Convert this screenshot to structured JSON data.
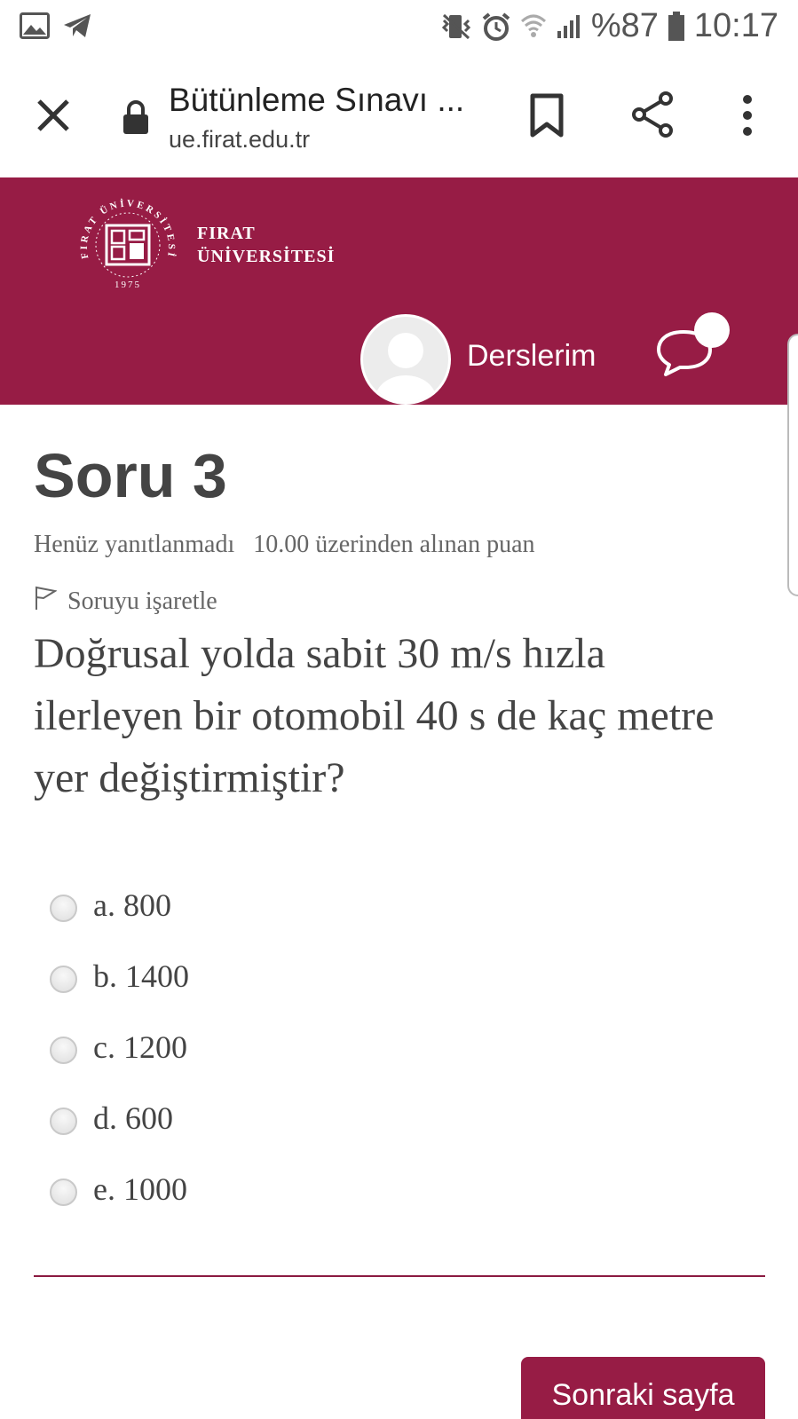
{
  "status_bar": {
    "battery": "%87",
    "time": "10:17",
    "icons": [
      "gallery-icon",
      "telegram-icon",
      "vibrate-icon",
      "alarm-icon",
      "wifi-icon",
      "signal-icon",
      "battery-icon"
    ]
  },
  "browser": {
    "page_title": "Bütünleme Sınavı ...",
    "url": "ue.firat.edu.tr",
    "icons": [
      "close-icon",
      "lock-icon",
      "bookmark-icon",
      "share-icon",
      "more-vert-icon"
    ]
  },
  "header": {
    "logo_line1": "FIRAT",
    "logo_line2": "ÜNİVERSİTESİ",
    "seal_text": "FIRAT ÜNİVERSİTESİ",
    "seal_year": "1975",
    "nav_label": "Derslerim",
    "brand_color": "#971c45"
  },
  "question": {
    "title": "Soru 3",
    "status": "Henüz yanıtlanmadı",
    "mark": "10.00 üzerinden alınan puan",
    "flag_label": "Soruyu işaretle",
    "text": "Doğrusal yolda sabit 30 m/s hızla ilerleyen bir otomobil 40 s de kaç metre yer değiştirmiştir?",
    "answers": [
      {
        "label": "a. 800",
        "selected": false
      },
      {
        "label": "b. 1400",
        "selected": false
      },
      {
        "label": "c. 1200",
        "selected": false
      },
      {
        "label": "d. 600",
        "selected": false
      },
      {
        "label": "e. 1000",
        "selected": false
      }
    ]
  },
  "navigation": {
    "next_label": "Sonraki sayfa"
  }
}
